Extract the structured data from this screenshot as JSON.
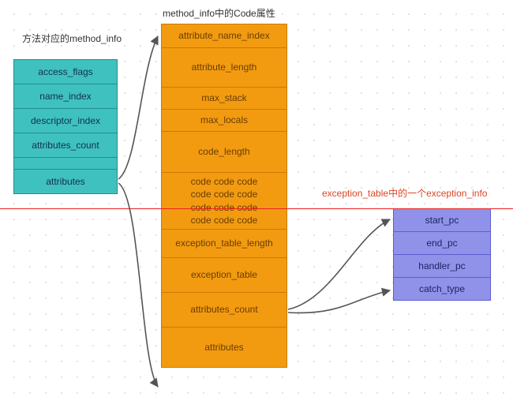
{
  "titles": {
    "left": "方法对应的method_info",
    "center": "method_info中的Code属性",
    "right": "exception_table中的一个exception_info"
  },
  "teal": {
    "c0": "access_flags",
    "c1": "name_index",
    "c2": "descriptor_index",
    "c3": "attributes_count",
    "c4": "attributes"
  },
  "orange": {
    "c0": "attribute_name_index",
    "c1": "attribute_length",
    "c2": "max_stack",
    "c3": "max_locals",
    "c4": "code_length",
    "c5": "code code code\ncode code code\ncode code code\ncode code code",
    "c6": "exception_table_length",
    "c7": "exception_table",
    "c8": "attributes_count",
    "c9": "attributes"
  },
  "purple": {
    "c0": "start_pc",
    "c1": "end_pc",
    "c2": "handler_pc",
    "c3": "catch_type"
  },
  "chart_data": {
    "type": "table",
    "title": "Java class file structure: method_info → Code attribute → exception_table entry",
    "series": [
      {
        "name": "方法对应的method_info",
        "values": [
          "access_flags",
          "name_index",
          "descriptor_index",
          "attributes_count",
          "attributes"
        ]
      },
      {
        "name": "method_info中的Code属性",
        "values": [
          "attribute_name_index",
          "attribute_length",
          "max_stack",
          "max_locals",
          "code_length",
          "code",
          "exception_table_length",
          "exception_table",
          "attributes_count",
          "attributes"
        ]
      },
      {
        "name": "exception_table中的一个exception_info",
        "values": [
          "start_pc",
          "end_pc",
          "handler_pc",
          "catch_type"
        ]
      }
    ],
    "edges": [
      {
        "from": "method_info.attributes",
        "to": "Code.attribute_name_index"
      },
      {
        "from": "method_info.attributes",
        "to": "Code.attributes"
      },
      {
        "from": "Code.exception_table",
        "to": "exception_info.start_pc"
      },
      {
        "from": "Code.exception_table",
        "to": "exception_info.catch_type"
      }
    ]
  }
}
